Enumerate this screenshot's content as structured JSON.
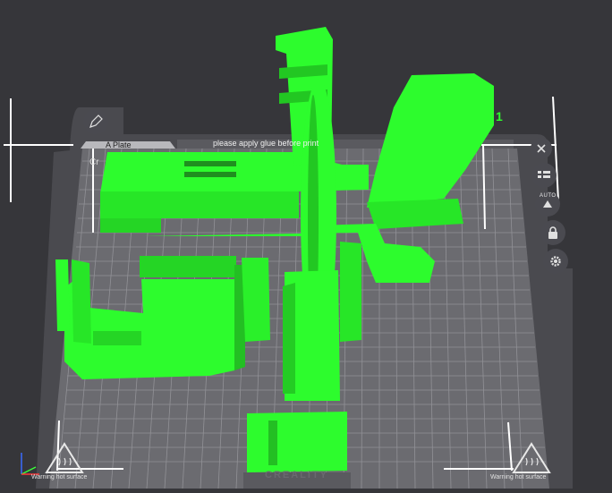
{
  "plate": {
    "name": "A Plate",
    "note": "please apply glue before print",
    "plate_number": "1",
    "brand": "CREALITY",
    "warning_left": "Warning hot surface",
    "warning_right": "Warning hot surface",
    "cut_label": "Cr"
  },
  "toolbar": {
    "arrange_icon": "grid-arrange-icon",
    "auto_label": "AUTO",
    "lock_icon": "lock-icon",
    "settings_icon": "gear-icon"
  },
  "colors": {
    "background": "#36363a",
    "bed": "#6b6b70",
    "grid": "#9a9a9e",
    "model": "#2dfc2d",
    "bounding_box": "#ffffff"
  }
}
